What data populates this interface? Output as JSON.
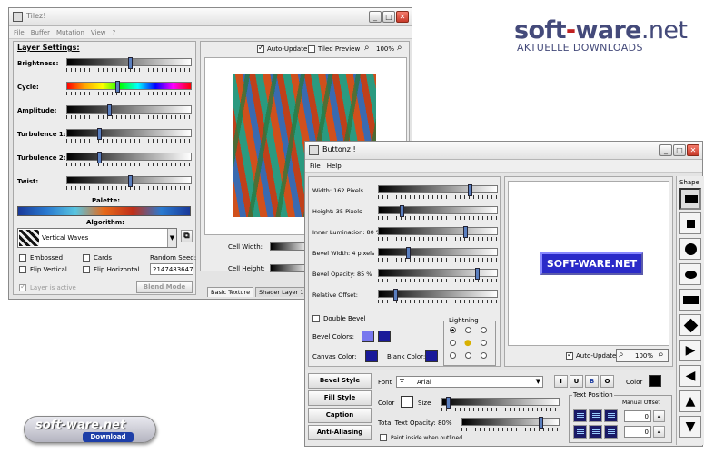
{
  "watermark": {
    "brand_soft": "soft",
    "brand_ware": "ware",
    "brand_net": ".net",
    "brand_sub": "AKTUELLE DOWNLOADS",
    "badge_title": "soft-ware.net",
    "badge_sub": "Download"
  },
  "tilez": {
    "title": "Tilez!",
    "menu": [
      "File",
      "Buffer",
      "Mutation",
      "View",
      "?"
    ],
    "layer_settings": "Layer Settings:",
    "sliders": [
      {
        "label": "Brightness:",
        "level": 0.5
      },
      {
        "label": "Cycle:",
        "level": 0.4
      },
      {
        "label": "Amplitude:",
        "level": 0.33
      },
      {
        "label": "Turbulence 1:",
        "level": 0.25
      },
      {
        "label": "Turbulence 2:",
        "level": 0.25
      },
      {
        "label": "Twist:",
        "level": 0.5
      }
    ],
    "palette_label": "Palette:",
    "algorithm_label": "Algorithm:",
    "algorithm_value": "Vertical Waves",
    "options": {
      "embossed": "Embossed",
      "cards": "Cards",
      "flip_vertical": "Flip Vertical",
      "flip_horizontal": "Flip Horizontal"
    },
    "random_seed_label": "Random Seed:",
    "random_seed_value": "2147483647",
    "layer_active": "Layer is active",
    "blend_mode": "Blend Mode",
    "auto_update": "Auto-Update",
    "tiled_preview": "Tiled Preview",
    "zoom": "100%",
    "cell_width": "Cell Width:",
    "cell_height": "Cell Height:",
    "tab_basic": "Basic Texture",
    "tab_shader": "Shader Layer 1"
  },
  "buttonz": {
    "title": "Buttonz !",
    "menu": [
      "File",
      "Help"
    ],
    "sliders": [
      {
        "label": "Width: 162 Pixels",
        "level": 0.78
      },
      {
        "label": "Height: 35 Pixels",
        "level": 0.18
      },
      {
        "label": "Inner Lumination: 80 %",
        "level": 0.74
      },
      {
        "label": "Bevel Width: 4 pixels",
        "level": 0.24
      },
      {
        "label": "Bevel Opacity: 85 %",
        "level": 0.84
      },
      {
        "label": "Relative Offset:",
        "level": 0.13
      }
    ],
    "double_bevel": "Double Bevel",
    "lightning": "Lightning",
    "bevel_colors": "Bevel Colors:",
    "canvas_color": "Canvas Color:",
    "blank_color": "Blank Color:",
    "preview_text": "SOFT-WARE.NET",
    "auto_update": "Auto-Update",
    "zoom": "100%",
    "shape_label": "Shape",
    "side_buttons": [
      "Bevel Style",
      "Fill Style",
      "Caption",
      "Anti-Aliasing"
    ],
    "font_label": "Font",
    "font_value": "Arial",
    "color_label": "Color",
    "size_label": "Size",
    "opacity_label": "Total Text Opacity: 80%",
    "paint_inside": "Paint inside when outlined",
    "text_position": "Text Position",
    "manual_offset": "Manual Offset",
    "offset_x": "0",
    "offset_y": "0",
    "style_buttons": [
      "I",
      "U",
      "B",
      "O"
    ]
  },
  "colors": {
    "bevel1": "#7777ee",
    "bevel2": "#1a1a99",
    "canvas": "#1a1a99",
    "blank": "#1a1a99",
    "button_bg": "#2a2ac8",
    "text_color": "#000000"
  }
}
